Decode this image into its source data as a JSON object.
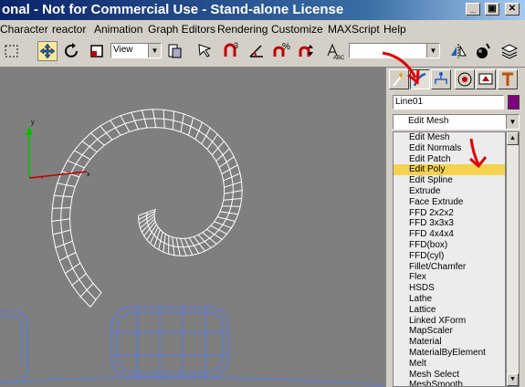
{
  "window": {
    "title": "onal - Not for Commercial Use - Stand-alone License",
    "buttons": [
      "_",
      "▣",
      "✕"
    ]
  },
  "menubar": {
    "items": [
      "Character",
      "reactor",
      "Animation",
      "Graph Editors",
      "Rendering",
      "Customize",
      "MAXScript",
      "Help"
    ]
  },
  "toolbar": {
    "coord_system": "View",
    "named_selection": ""
  },
  "command_panel": {
    "tabs": [
      "create",
      "modify",
      "hierarchy",
      "motion",
      "display",
      "utilities"
    ],
    "active_tab": "modify",
    "object_name": "Line01",
    "object_color": "#800080",
    "modifier_list_label": "Edit Mesh",
    "modifiers": [
      "Edit Mesh",
      "Edit Normals",
      "Edit Patch",
      "Edit Poly",
      "Edit Spline",
      "Extrude",
      "Face Extrude",
      "FFD 2x2x2",
      "FFD 3x3x3",
      "FFD 4x4x4",
      "FFD(box)",
      "FFD(cyl)",
      "Fillet/Chamfer",
      "Flex",
      "HSDS",
      "Lathe",
      "Lattice",
      "Linked XForm",
      "MapScaler",
      "Material",
      "MaterialByElement",
      "Melt",
      "Mesh Select",
      "MeshSmooth"
    ],
    "selected_modifier": "Edit Poly"
  },
  "viewport": {
    "background": "#7f7f7f",
    "gizmo_axes": [
      "y",
      "x"
    ]
  },
  "annotation_color": "#e00000"
}
